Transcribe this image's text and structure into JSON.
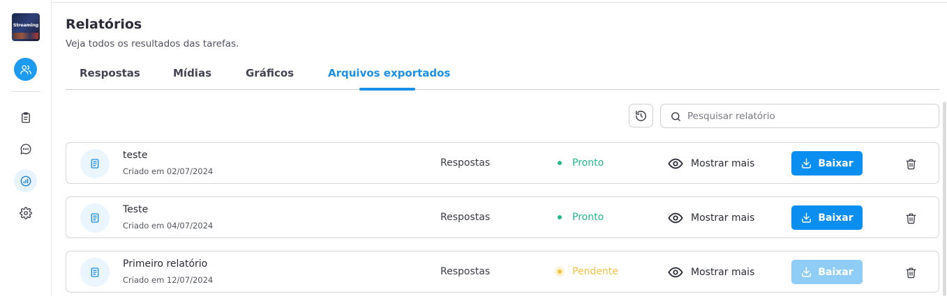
{
  "sidebar": {
    "logo_text": "Streaming",
    "items": [
      {
        "icon": "users-icon",
        "state": "active"
      },
      {
        "icon": "clipboard-icon",
        "state": "normal"
      },
      {
        "icon": "chat-icon",
        "state": "normal"
      },
      {
        "icon": "chart-icon",
        "state": "selected"
      },
      {
        "icon": "gear-icon",
        "state": "normal"
      }
    ]
  },
  "header": {
    "title": "Relatórios",
    "subtitle": "Veja todos os resultados das tarefas."
  },
  "tabs": [
    {
      "label": "Respostas",
      "active": false
    },
    {
      "label": "Mídias",
      "active": false
    },
    {
      "label": "Gráficos",
      "active": false
    },
    {
      "label": "Arquivos exportados",
      "active": true
    }
  ],
  "toolbar": {
    "search_placeholder": "Pesquisar relatório",
    "search_value": ""
  },
  "reports": [
    {
      "name": "teste",
      "created": "Criado em 02/07/2024",
      "type": "Respostas",
      "status": "Pronto",
      "status_kind": "ready",
      "more_label": "Mostrar mais",
      "download_label": "Baixar",
      "download_enabled": true
    },
    {
      "name": "Teste",
      "created": "Criado em 04/07/2024",
      "type": "Respostas",
      "status": "Pronto",
      "status_kind": "ready",
      "more_label": "Mostrar mais",
      "download_label": "Baixar",
      "download_enabled": true
    },
    {
      "name": "Primeiro relatório",
      "created": "Criado em 12/07/2024",
      "type": "Respostas",
      "status": "Pendente",
      "status_kind": "pending",
      "more_label": "Mostrar mais",
      "download_label": "Baixar",
      "download_enabled": false
    }
  ],
  "colors": {
    "accent": "#1a8fe6",
    "ready": "#1fb98a",
    "pending": "#f5c242",
    "download": "#0a8ff0",
    "download_disabled": "#8fcdf7"
  }
}
